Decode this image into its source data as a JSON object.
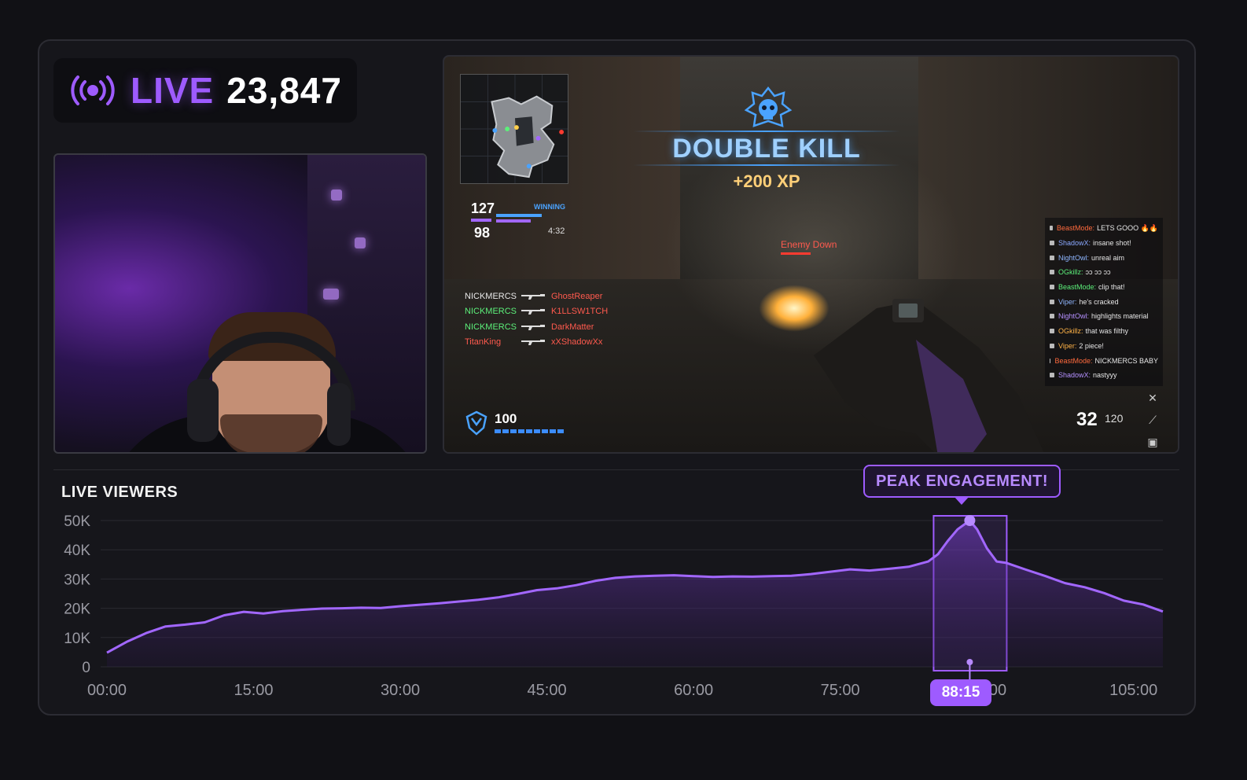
{
  "live_badge": {
    "label": "LIVE",
    "viewer_count": "23,847"
  },
  "game_hud": {
    "banner": {
      "title": "DOUBLE KILL",
      "xp": "+200 XP"
    },
    "score": {
      "team_a": "127",
      "team_b": "98",
      "status": "WINNING",
      "timer": "4:32"
    },
    "killfeed": [
      {
        "killer": "NICKMERCS",
        "victim": "GhostReaper",
        "killer_color": "#e8e8e8"
      },
      {
        "killer": "NICKMERCS",
        "victim": "K1LLSW1TCH",
        "killer_color": "#5cf07a"
      },
      {
        "killer": "NICKMERCS",
        "victim": "DarkMatter",
        "killer_color": "#5cf07a"
      },
      {
        "killer": "TitanKing",
        "victim": "xXShadowXx",
        "killer_color": "#ff5a4e"
      }
    ],
    "enemy_down": "Enemy Down",
    "health": "100",
    "ammo": {
      "mag": "32",
      "reserve": "120"
    },
    "chat": [
      {
        "user": "BeastMode:",
        "msg": "LETS GOOO 🔥🔥",
        "color": "#ff6a3d"
      },
      {
        "user": "ShadowX:",
        "msg": "insane shot!",
        "color": "#8aa8ff"
      },
      {
        "user": "NightOwl:",
        "msg": "unreal aim",
        "color": "#8fb6ff"
      },
      {
        "user": "OGkillz:",
        "msg": "ɔɔ ɔɔ ɔɔ",
        "color": "#5cf07a"
      },
      {
        "user": "BeastMode:",
        "msg": "clip that!",
        "color": "#5cf07a"
      },
      {
        "user": "Viper:",
        "msg": "he's cracked",
        "color": "#8fb6ff"
      },
      {
        "user": "NightOwl:",
        "msg": "highlights material",
        "color": "#b590ff"
      },
      {
        "user": "OGkillz:",
        "msg": "that was filthy",
        "color": "#ffb347"
      },
      {
        "user": "Viper:",
        "msg": "2 piece!",
        "color": "#ffb347"
      },
      {
        "user": "BeastMode:",
        "msg": "NICKMERCS BABY",
        "color": "#ff6a3d"
      },
      {
        "user": "ShadowX:",
        "msg": "nastyyy",
        "color": "#b590ff"
      }
    ]
  },
  "chart_data": {
    "type": "area",
    "title": "LIVE VIEWERS",
    "xlabel": "",
    "ylabel": "",
    "x_ticks": [
      "00:00",
      "15:00",
      "30:00",
      "45:00",
      "60:00",
      "75:00",
      "90:00",
      "105:00"
    ],
    "y_ticks": [
      "0",
      "10K",
      "20K",
      "30K",
      "40K",
      "50K"
    ],
    "ylim": [
      0,
      50000
    ],
    "xlim_minutes": [
      0,
      108
    ],
    "series": [
      {
        "x_minutes": [
          0,
          2,
          4,
          6,
          8,
          10,
          12,
          14,
          16,
          18,
          20,
          22,
          24,
          26,
          28,
          30,
          32,
          34,
          36,
          38,
          40,
          42,
          44,
          46,
          48,
          50,
          52,
          54,
          56,
          58,
          60,
          62,
          64,
          66,
          68,
          70,
          72,
          74,
          76,
          78,
          80,
          82,
          84,
          85,
          86,
          87,
          88.25,
          89,
          90,
          91,
          92,
          94,
          96,
          98,
          100,
          102,
          104,
          106,
          108
        ],
        "values": [
          4800,
          8500,
          11500,
          13800,
          14400,
          15200,
          17600,
          18800,
          18200,
          19000,
          19500,
          19900,
          20000,
          20200,
          20100,
          20700,
          21200,
          21700,
          22300,
          22900,
          23700,
          24900,
          26200,
          26800,
          27900,
          29400,
          30400,
          30900,
          31100,
          31300,
          31000,
          30700,
          30900,
          30800,
          31000,
          31100,
          31700,
          32500,
          33300,
          32900,
          33500,
          34200,
          36000,
          38500,
          43000,
          47000,
          50000,
          47000,
          40500,
          36000,
          35500,
          33200,
          31000,
          28600,
          27200,
          25200,
          22600,
          21300,
          18900
        ]
      }
    ],
    "grid": true,
    "highlight": {
      "label": "PEAK ENGAGEMENT!",
      "time": "88:15",
      "value": 50000
    }
  }
}
